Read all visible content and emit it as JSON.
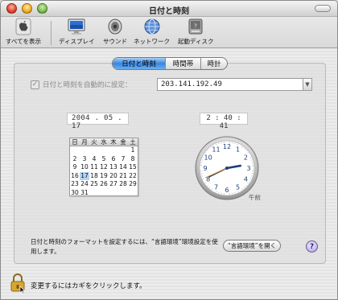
{
  "window": {
    "title": "日付と時刻"
  },
  "toolbar": {
    "items": [
      {
        "label": "すべてを表示",
        "icon": "apple-icon"
      },
      {
        "label": "ディスプレイ",
        "icon": "display-icon"
      },
      {
        "label": "サウンド",
        "icon": "sound-icon"
      },
      {
        "label": "ネットワーク",
        "icon": "network-icon"
      },
      {
        "label": "起動ディスク",
        "icon": "startup-disk-icon"
      }
    ]
  },
  "tabs": [
    {
      "label": "日付と時刻",
      "active": true
    },
    {
      "label": "時間帯",
      "active": false
    },
    {
      "label": "時計",
      "active": false
    }
  ],
  "auto_set": {
    "label": "日付と時刻を自動的に設定：",
    "checked": true,
    "server": "203.141.192.49"
  },
  "date": "2004 . 05 . 17",
  "time": "2 : 40 : 41",
  "calendar": {
    "weekdays": [
      "日",
      "月",
      "火",
      "水",
      "木",
      "金",
      "土"
    ],
    "weeks": [
      [
        "",
        "",
        "",
        "",
        "",
        "",
        "1"
      ],
      [
        "2",
        "3",
        "4",
        "5",
        "6",
        "7",
        "8"
      ],
      [
        "9",
        "10",
        "11",
        "12",
        "13",
        "14",
        "15"
      ],
      [
        "16",
        "17",
        "18",
        "19",
        "20",
        "21",
        "22"
      ],
      [
        "23",
        "24",
        "25",
        "26",
        "27",
        "28",
        "29"
      ],
      [
        "30",
        "31",
        "",
        "",
        "",
        "",
        ""
      ]
    ],
    "selected_day": "17"
  },
  "clock": {
    "hours": 2,
    "minutes": 40,
    "seconds": 41,
    "ampm": "午前"
  },
  "format_note": "日付と時刻のフォーマットを設定するには、“言語環境”環境設定を使用します。",
  "open_intl_button": "“言語環境”を開く",
  "help_button": "?",
  "lock_note": "変更するにはカギをクリックします。"
}
